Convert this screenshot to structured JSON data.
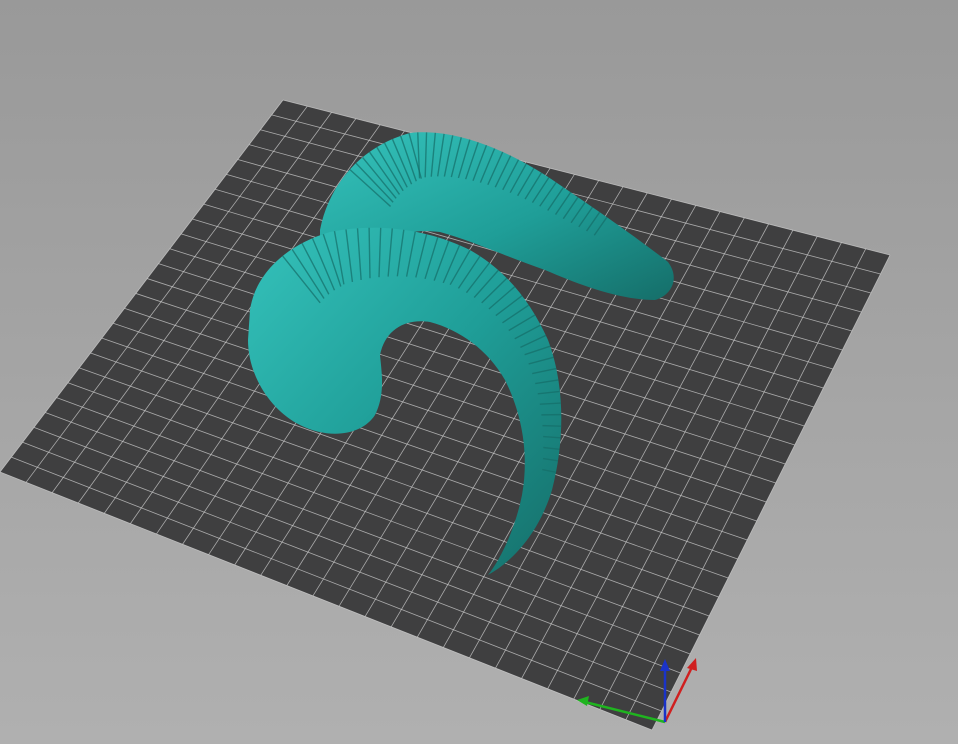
{
  "viewport": {
    "background_top": "#999999",
    "background_bottom": "#b0b0b0"
  },
  "bed": {
    "surface_color": "#3f3f40",
    "grid_line_color": "#cfcfcf",
    "grid_divisions": 25
  },
  "model": {
    "name": "ram-horns",
    "color": "#1f9e98",
    "highlight_color": "#35c2bb",
    "shadow_color": "#156e69"
  },
  "axes": {
    "x_color": "#d01f1f",
    "y_color": "#1fb41f",
    "z_color": "#1a33c8"
  }
}
